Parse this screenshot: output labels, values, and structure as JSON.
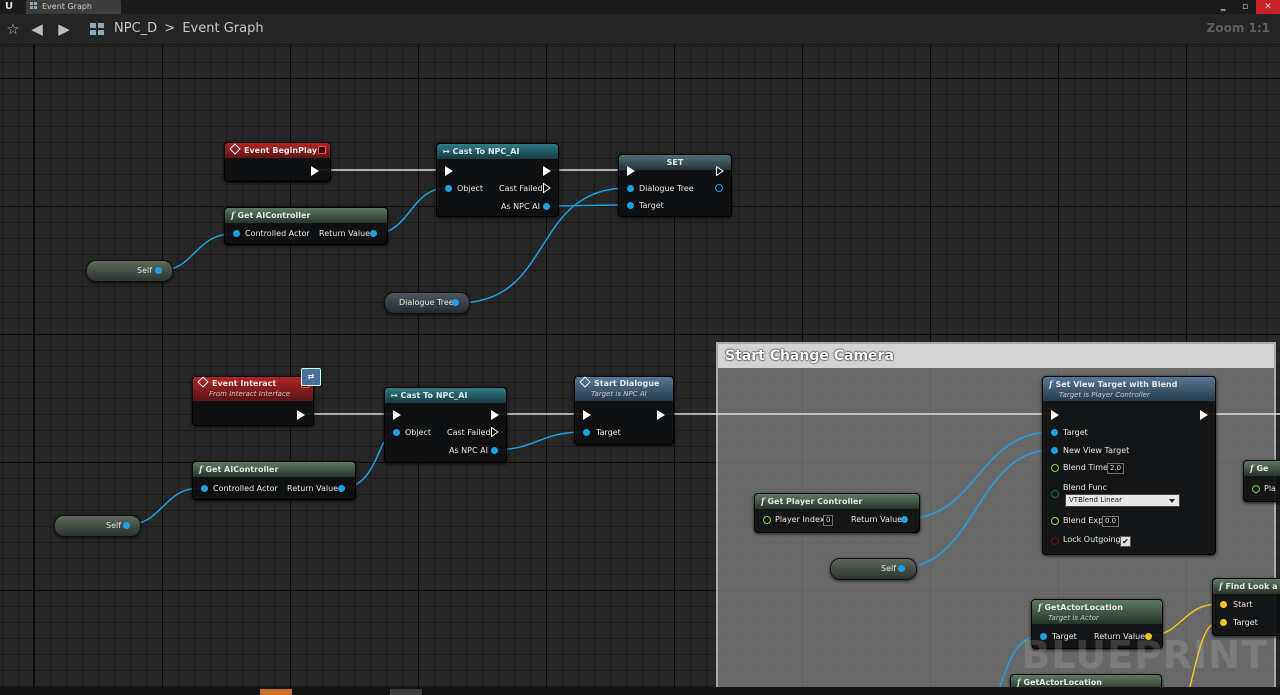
{
  "window": {
    "tab_title": "Event Graph",
    "controls": {
      "minimize": "‗",
      "restore": "▫",
      "close": "✕"
    }
  },
  "toolbar": {
    "favorite_icon": "star-icon",
    "back_icon": "arrow-left-icon",
    "forward_icon": "arrow-right-icon",
    "breadcrumb_root": "NPC_D",
    "breadcrumb_separator": ">",
    "breadcrumb_current": "Event Graph",
    "zoom": "Zoom 1:1"
  },
  "graph": {
    "comment": {
      "title": "Start Change Camera",
      "color": "#d4d4d4"
    },
    "nodes": {
      "event_beginplay": {
        "title": "Event BeginPlay"
      },
      "cast_npc_ai_1": {
        "title": "Cast To NPC_AI",
        "object": "Object",
        "cast_failed": "Cast Failed",
        "as_npc_ai": "As NPC AI"
      },
      "set_node": {
        "title": "SET",
        "dialogue_tree": "Dialogue Tree",
        "target": "Target"
      },
      "get_aicontroller_1": {
        "title": "Get AIController",
        "controlled_actor": "Controlled Actor",
        "return_value": "Return Value"
      },
      "self_var_1": {
        "label": "Self"
      },
      "dialogue_tree_var": {
        "label": "Dialogue Tree"
      },
      "event_interact": {
        "title": "Event Interact",
        "subtitle": "From Interact Interface"
      },
      "cast_npc_ai_2": {
        "title": "Cast To NPC_AI",
        "object": "Object",
        "cast_failed": "Cast Failed",
        "as_npc_ai": "As NPC AI"
      },
      "start_dialogue": {
        "title": "Start Dialogue",
        "subtitle": "Target is NPC AI",
        "target": "Target"
      },
      "get_aicontroller_2": {
        "title": "Get AIController",
        "controlled_actor": "Controlled Actor",
        "return_value": "Return Value"
      },
      "self_var_2": {
        "label": "Self"
      },
      "set_view_target": {
        "title": "Set View Target with Blend",
        "subtitle": "Target is Player Controller",
        "target": "Target",
        "new_view_target": "New View Target",
        "blend_time": "Blend Time",
        "blend_time_value": "2.0",
        "blend_func": "Blend Func",
        "blend_func_value": "VTBlend Linear",
        "blend_exp": "Blend Exp",
        "blend_exp_value": "0.0",
        "lock_outgoing": "Lock Outgoing",
        "lock_outgoing_checked": true
      },
      "get_player_controller": {
        "title": "Get Player Controller",
        "player_index": "Player Index",
        "player_index_value": "0",
        "return_value": "Return Value"
      },
      "self_var_3": {
        "label": "Self"
      },
      "get_actor_location_1": {
        "title": "GetActorLocation",
        "subtitle": "Target is Actor",
        "target": "Target",
        "return_value": "Return Value"
      },
      "get_actor_location_2": {
        "title": "GetActorLocation"
      },
      "find_look_at": {
        "title": "Find Look a",
        "start": "Start",
        "target": "Target"
      },
      "offscreen_node": {
        "title": "Ge",
        "pin": "Pla"
      }
    },
    "colors": {
      "exec": "#ffffff",
      "object": "#1ea1e4",
      "vector": "#f0c418",
      "float": "#8ed047"
    }
  },
  "watermark": "BLUEPRINT"
}
